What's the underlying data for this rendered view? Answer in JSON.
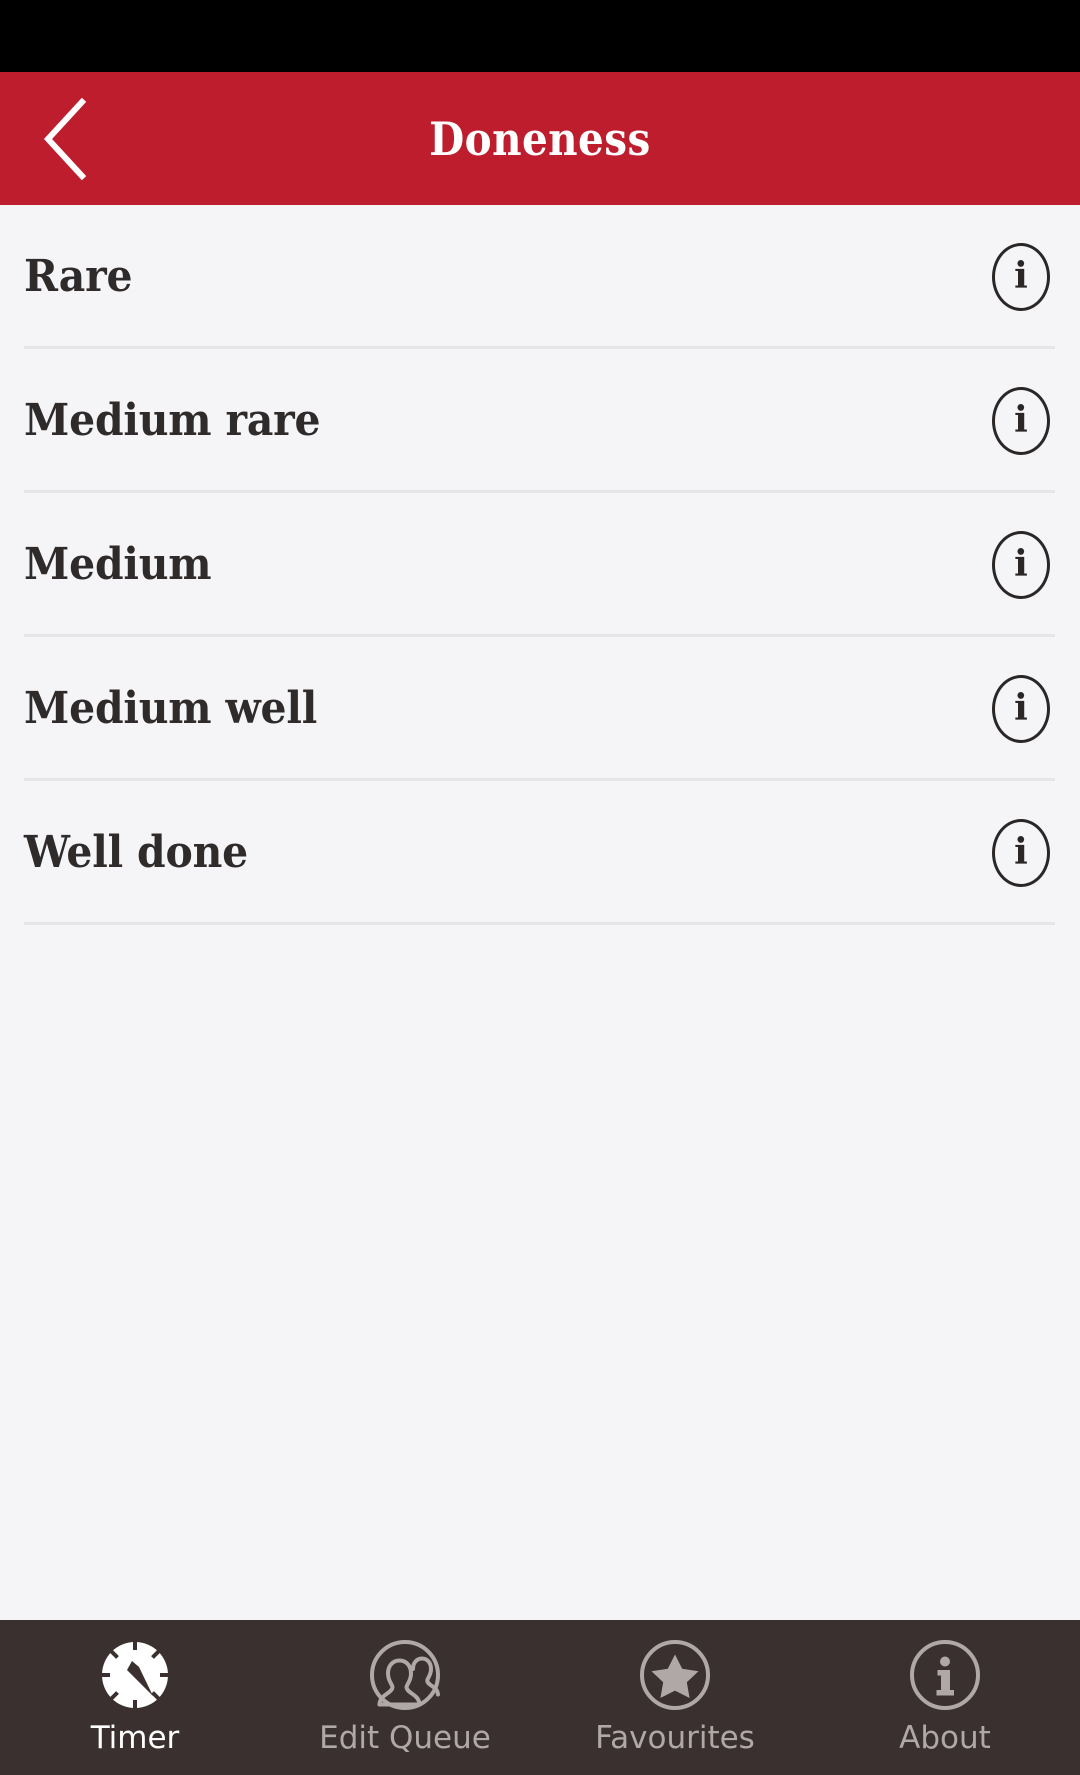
{
  "header": {
    "title": "Doneness",
    "back_icon": "chevron-left-icon",
    "background_color": "#bd1d2d",
    "title_color": "#ffffff"
  },
  "status_bar": {
    "background_color": "#000000"
  },
  "list": {
    "background_color": "#f5f5f7",
    "divider_color": "#e4e5e7",
    "text_color": "#2f2b2b",
    "items": [
      {
        "label": "Rare",
        "info_icon": "info-circle-icon",
        "info_glyph": "i"
      },
      {
        "label": "Medium rare",
        "info_icon": "info-circle-icon",
        "info_glyph": "i"
      },
      {
        "label": "Medium",
        "info_icon": "info-circle-icon",
        "info_glyph": "i"
      },
      {
        "label": "Medium well",
        "info_icon": "info-circle-icon",
        "info_glyph": "i"
      },
      {
        "label": "Well done",
        "info_icon": "info-circle-icon",
        "info_glyph": "i"
      }
    ]
  },
  "tab_bar": {
    "background_color": "#3a302f",
    "active_color": "#ffffff",
    "inactive_color": "#b0a8a6",
    "tabs": [
      {
        "label": "Timer",
        "icon": "clock-timer-icon",
        "active": true
      },
      {
        "label": "Edit Queue",
        "icon": "two-people-icon",
        "active": false
      },
      {
        "label": "Favourites",
        "icon": "star-circle-icon",
        "active": false
      },
      {
        "label": "About",
        "icon": "info-circle-icon",
        "active": false
      }
    ]
  }
}
